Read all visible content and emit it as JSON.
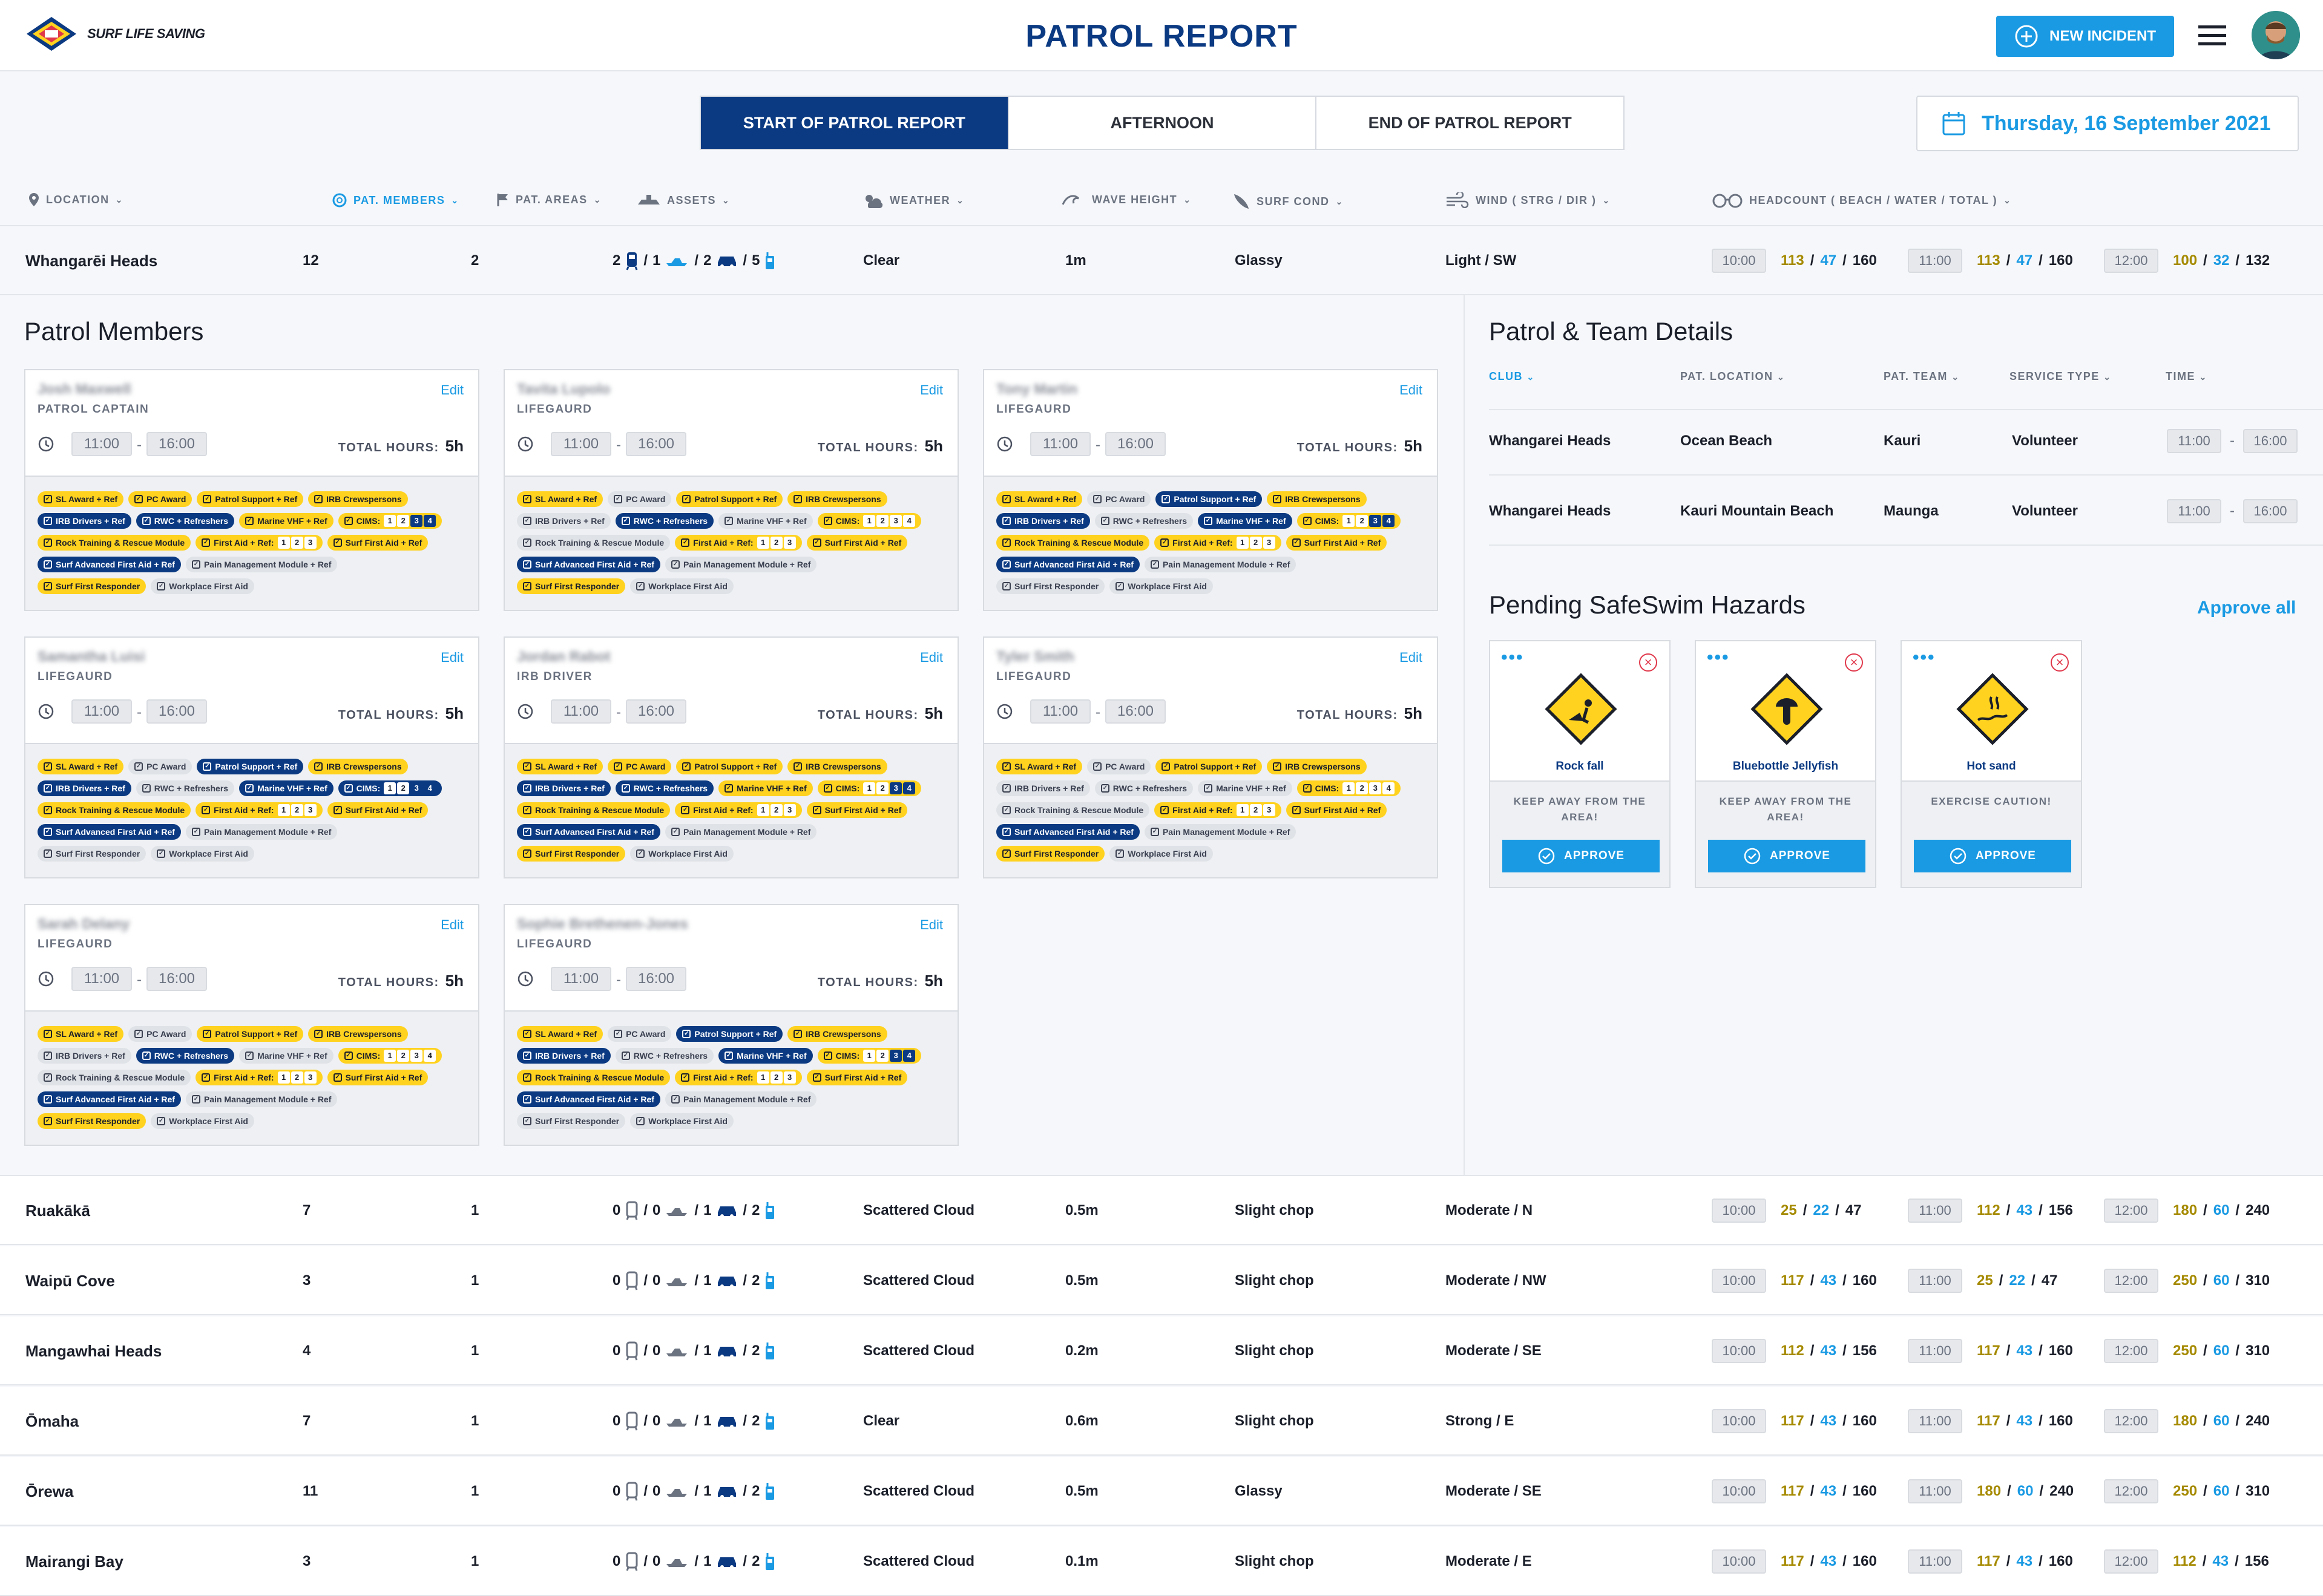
{
  "header": {
    "logo_text": "SURF LIFE SAVING",
    "title": "PATROL REPORT",
    "new_incident": "NEW INCIDENT"
  },
  "tabs": [
    "START OF PATROL REPORT",
    "AFTERNOON",
    "END OF PATROL REPORT"
  ],
  "date": "Thursday, 16 September 2021",
  "columns": [
    "LOCATION",
    "PAT. MEMBERS",
    "PAT. AREAS",
    "ASSETS",
    "WEATHER",
    "WAVE HEIGHT",
    "SURF COND",
    "WIND ( STRG / DIR )",
    "HEADCOUNT ( BEACH / WATER / TOTAL )"
  ],
  "main_row": {
    "location": "Whangarēi Heads",
    "members": "12",
    "areas": "2",
    "assets": [
      "2",
      "1",
      "2",
      "5"
    ],
    "weather": "Clear",
    "wave": "1m",
    "surf": "Glassy",
    "wind": "Light / SW",
    "headcounts": [
      {
        "time": "10:00",
        "beach": "113",
        "water": "47",
        "total": "160"
      },
      {
        "time": "11:00",
        "beach": "113",
        "water": "47",
        "total": "160"
      },
      {
        "time": "12:00",
        "beach": "100",
        "water": "32",
        "total": "132"
      }
    ]
  },
  "patrol_members_title": "Patrol Members",
  "member_labels": {
    "edit": "Edit",
    "total_hours": "TOTAL HOURS:"
  },
  "members": [
    {
      "name": "Josh Maxwell",
      "role": "PATROL CAPTAIN",
      "start": "11:00",
      "end": "16:00",
      "hours": "5h"
    },
    {
      "name": "Tavita Lupolo",
      "role": "LIFEGAURD",
      "start": "11:00",
      "end": "16:00",
      "hours": "5h"
    },
    {
      "name": "Tony Martin",
      "role": "LIFEGAURD",
      "start": "11:00",
      "end": "16:00",
      "hours": "5h"
    },
    {
      "name": "Samantha Luisi",
      "role": "LIFEGAURD",
      "start": "11:00",
      "end": "16:00",
      "hours": "5h"
    },
    {
      "name": "Jordan Rabot",
      "role": "IRB DRIVER",
      "start": "11:00",
      "end": "16:00",
      "hours": "5h"
    },
    {
      "name": "Tyler Smith",
      "role": "LIFEGAURD",
      "start": "11:00",
      "end": "16:00",
      "hours": "5h"
    },
    {
      "name": "Sarah Delany",
      "role": "LIFEGAURD",
      "start": "11:00",
      "end": "16:00",
      "hours": "5h"
    },
    {
      "name": "Sophie Brethenen-Jones",
      "role": "LIFEGAURD",
      "start": "11:00",
      "end": "16:00",
      "hours": "5h"
    }
  ],
  "badge_labels": {
    "sl": "SL Award + Ref",
    "pc": "PC Award",
    "ps": "Patrol Support + Ref",
    "irbc": "IRB Crewspersons",
    "irbd": "IRB Drivers + Ref",
    "rwc": "RWC + Refreshers",
    "vhf": "Marine VHF + Ref",
    "cims": "CIMS:",
    "rtrm": "Rock Training & Rescue Module",
    "fa": "First Aid + Ref:",
    "sfa": "Surf First Aid + Ref",
    "safa": "Surf Advanced First Aid + Ref",
    "pmm": "Pain Management Module + Ref",
    "sfr": "Surf First Responder",
    "wfa": "Workplace First Aid",
    "n1": "1",
    "n2": "2",
    "n3": "3",
    "n4": "4"
  },
  "team_title": "Patrol & Team Details",
  "team_cols": [
    "CLUB",
    "PAT. LOCATION",
    "PAT. TEAM",
    "SERVICE TYPE",
    "TIME"
  ],
  "team_rows": [
    {
      "club": "Whangarei Heads",
      "location": "Ocean Beach",
      "team": "Kauri",
      "service": "Volunteer",
      "start": "11:00",
      "end": "16:00"
    },
    {
      "club": "Whangarei Heads",
      "location": "Kauri Mountain Beach",
      "team": "Maunga",
      "service": "Volunteer",
      "start": "11:00",
      "end": "16:00"
    }
  ],
  "hazards_title": "Pending SafeSwim Hazards",
  "approve_all": "Approve all",
  "approve": "APPROVE",
  "hazards": [
    {
      "name": "Rock fall",
      "warning": "KEEP AWAY FROM THE AREA!"
    },
    {
      "name": "Bluebottle Jellyfish",
      "warning": "KEEP AWAY FROM THE AREA!"
    },
    {
      "name": "Hot sand",
      "warning": "EXERCISE CAUTION!"
    }
  ],
  "rows": [
    {
      "location": "Ruakākā",
      "members": "7",
      "areas": "1",
      "assets": [
        "0",
        "0",
        "1",
        "2"
      ],
      "weather": "Scattered Cloud",
      "wave": "0.5m",
      "surf": "Slight chop",
      "wind": "Moderate / N",
      "hc": [
        [
          "10:00",
          "25",
          "22",
          "47"
        ],
        [
          "11:00",
          "112",
          "43",
          "156"
        ],
        [
          "12:00",
          "180",
          "60",
          "240"
        ]
      ]
    },
    {
      "location": "Waipū Cove",
      "members": "3",
      "areas": "1",
      "assets": [
        "0",
        "0",
        "1",
        "2"
      ],
      "weather": "Scattered Cloud",
      "wave": "0.5m",
      "surf": "Slight chop",
      "wind": "Moderate / NW",
      "hc": [
        [
          "10:00",
          "117",
          "43",
          "160"
        ],
        [
          "11:00",
          "25",
          "22",
          "47"
        ],
        [
          "12:00",
          "250",
          "60",
          "310"
        ]
      ]
    },
    {
      "location": "Mangawhai Heads",
      "members": "4",
      "areas": "1",
      "assets": [
        "0",
        "0",
        "1",
        "2"
      ],
      "weather": "Scattered Cloud",
      "wave": "0.2m",
      "surf": "Slight chop",
      "wind": "Moderate / SE",
      "hc": [
        [
          "10:00",
          "112",
          "43",
          "156"
        ],
        [
          "11:00",
          "117",
          "43",
          "160"
        ],
        [
          "12:00",
          "250",
          "60",
          "310"
        ]
      ]
    },
    {
      "location": "Ōmaha",
      "members": "7",
      "areas": "1",
      "assets": [
        "0",
        "0",
        "1",
        "2"
      ],
      "weather": "Clear",
      "wave": "0.6m",
      "surf": "Slight chop",
      "wind": "Strong / E",
      "hc": [
        [
          "10:00",
          "117",
          "43",
          "160"
        ],
        [
          "11:00",
          "117",
          "43",
          "160"
        ],
        [
          "12:00",
          "180",
          "60",
          "240"
        ]
      ]
    },
    {
      "location": "Ōrewa",
      "members": "11",
      "areas": "1",
      "assets": [
        "0",
        "0",
        "1",
        "2"
      ],
      "weather": "Scattered Cloud",
      "wave": "0.5m",
      "surf": "Glassy",
      "wind": "Moderate / SE",
      "hc": [
        [
          "10:00",
          "117",
          "43",
          "160"
        ],
        [
          "11:00",
          "180",
          "60",
          "240"
        ],
        [
          "12:00",
          "250",
          "60",
          "310"
        ]
      ]
    },
    {
      "location": "Mairangi Bay",
      "members": "3",
      "areas": "1",
      "assets": [
        "0",
        "0",
        "1",
        "2"
      ],
      "weather": "Scattered Cloud",
      "wave": "0.1m",
      "surf": "Slight chop",
      "wind": "Moderate / E",
      "hc": [
        [
          "10:00",
          "117",
          "43",
          "160"
        ],
        [
          "11:00",
          "117",
          "43",
          "160"
        ],
        [
          "12:00",
          "112",
          "43",
          "156"
        ]
      ]
    }
  ],
  "colors": {
    "navy": "#0b3a82",
    "accent": "#1a9ae3",
    "badge_yellow": "#ffd21f",
    "beach_count": "#a58a00"
  }
}
